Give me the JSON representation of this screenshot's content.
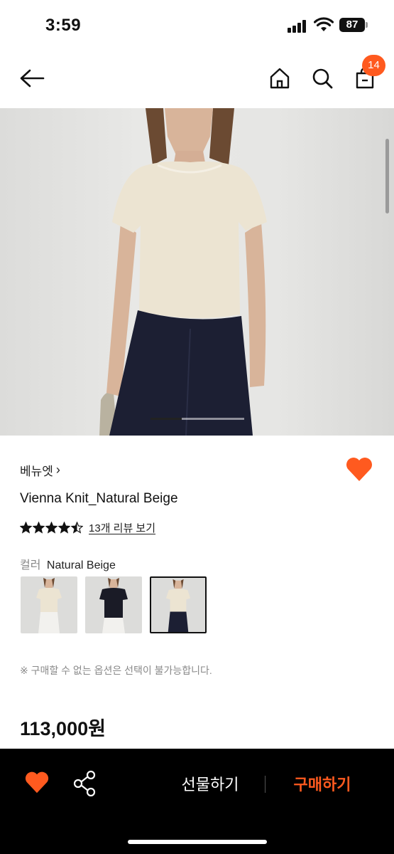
{
  "status_bar": {
    "time": "3:59",
    "battery": "87"
  },
  "header": {
    "cart_count": "14"
  },
  "product": {
    "brand": "베뉴엣",
    "brand_chevron": "›",
    "name": "Vienna Knit_Natural Beige",
    "rating": 4.5,
    "rating_max": 5,
    "review_link": "13개 리뷰 보기",
    "color_label": "컬러",
    "color_value": "Natural Beige",
    "swatches": [
      {
        "name": "Natural Beige top, white pants",
        "selected": false
      },
      {
        "name": "Black top, white pants",
        "selected": false
      },
      {
        "name": "Natural Beige top, navy pants",
        "selected": true
      }
    ],
    "notice": "※ 구매할 수 없는 옵션은 선택이 불가능합니다.",
    "price": "113,000원"
  },
  "image_carousel": {
    "slide": 1,
    "slide_count": 3
  },
  "bottom_bar": {
    "gift_label": "선물하기",
    "buy_label": "구매하기"
  },
  "colors": {
    "accent": "#ff5a1f",
    "dark": "#000000"
  },
  "icons": {
    "back": "arrow-left-icon",
    "home": "home-icon",
    "search": "search-icon",
    "cart": "shopping-bag-icon",
    "wish": "heart-icon",
    "share": "share-icon",
    "star": "star-icon"
  }
}
